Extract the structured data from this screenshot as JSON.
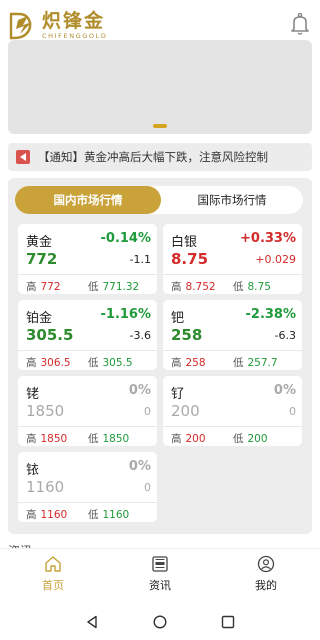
{
  "app": {
    "logo_cn": "炽锋金",
    "logo_en": "CHIFENGGOLD"
  },
  "notice": {
    "text": "【通知】黄金冲高后大幅下跌，注意风险控制"
  },
  "market": {
    "tabs": [
      {
        "label": "国内市场行情",
        "active": true
      },
      {
        "label": "国际市场行情",
        "active": false
      }
    ],
    "high_label": "高",
    "low_label": "低",
    "cards": [
      {
        "name": "黄金",
        "pct": "-0.14%",
        "price": "772",
        "change": "-1.1",
        "high": "772",
        "low": "771.32",
        "trend": "down"
      },
      {
        "name": "白银",
        "pct": "+0.33%",
        "price": "8.75",
        "change": "+0.029",
        "high": "8.752",
        "low": "8.75",
        "trend": "up"
      },
      {
        "name": "铂金",
        "pct": "-1.16%",
        "price": "305.5",
        "change": "-3.6",
        "high": "306.5",
        "low": "305.5",
        "trend": "down"
      },
      {
        "name": "钯",
        "pct": "-2.38%",
        "price": "258",
        "change": "-6.3",
        "high": "258",
        "low": "257.7",
        "trend": "down"
      },
      {
        "name": "铑",
        "pct": "0%",
        "price": "1850",
        "change": "0",
        "high": "1850",
        "low": "1850",
        "trend": "flat"
      },
      {
        "name": "钌",
        "pct": "0%",
        "price": "200",
        "change": "0",
        "high": "200",
        "low": "200",
        "trend": "flat"
      },
      {
        "name": "铱",
        "pct": "0%",
        "price": "1160",
        "change": "0",
        "high": "1160",
        "low": "1160",
        "trend": "flat"
      }
    ]
  },
  "section_peek": "资讯",
  "bottom_nav": [
    {
      "label": "首页",
      "icon": "home-icon",
      "active": true
    },
    {
      "label": "资讯",
      "icon": "news-icon",
      "active": false
    },
    {
      "label": "我的",
      "icon": "user-icon",
      "active": false
    }
  ],
  "colors": {
    "accent": "#c9a23a",
    "up": "#d42a2a",
    "down": "#1f9a3a",
    "flat": "#aaaaaa"
  }
}
